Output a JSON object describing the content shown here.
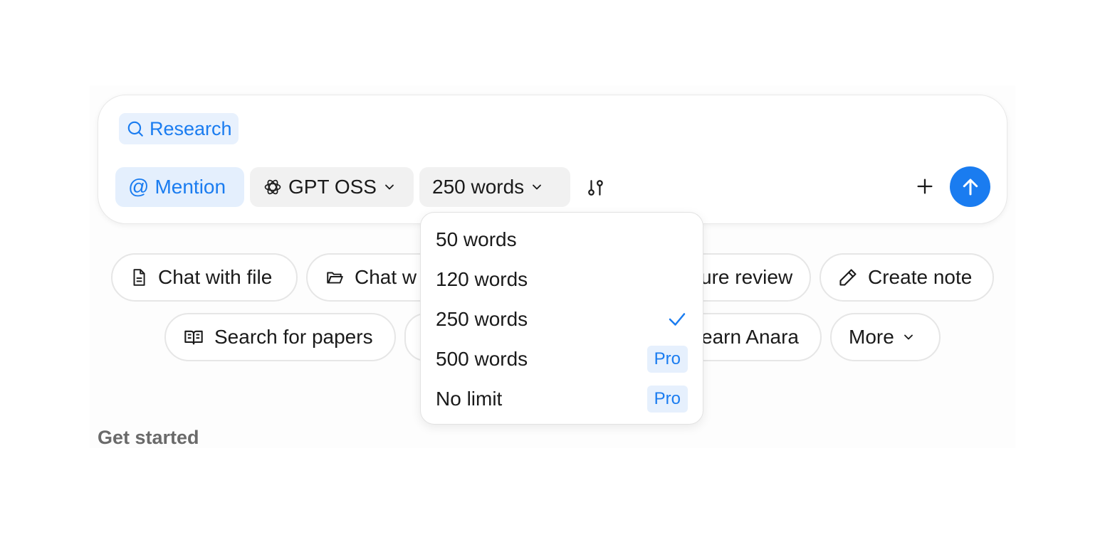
{
  "composer": {
    "mode_label": "Research",
    "mention_label": "Mention",
    "model_label": "GPT OSS",
    "length_label": "250 words"
  },
  "actions": {
    "chat_with_file": "Chat with file",
    "chat_with_folder": "Chat w",
    "literature_review": "ure review",
    "create_note": "Create note",
    "search_papers": "Search for papers",
    "learn_anara": "earn Anara",
    "more": "More"
  },
  "section": {
    "get_started": "Get started"
  },
  "length_menu": {
    "items": [
      {
        "label": "50 words"
      },
      {
        "label": "120 words"
      },
      {
        "label": "250 words",
        "selected": true
      },
      {
        "label": "500 words",
        "badge": "Pro"
      },
      {
        "label": "No limit",
        "badge": "Pro"
      }
    ]
  },
  "colors": {
    "accent": "#1a7cf0",
    "accent_bg": "#e4effd",
    "chip_bg": "#f1f1f1"
  }
}
